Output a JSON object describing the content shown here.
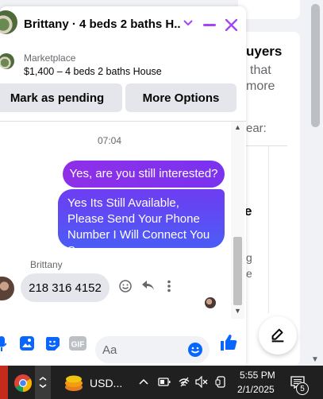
{
  "background": {
    "heading_fragment": "uyers",
    "line1": "that",
    "line2": "more",
    "line3": "ear:",
    "line4": "e",
    "line5": "g",
    "line6": "e"
  },
  "chat": {
    "title": "Brittany · 4 beds 2 baths H...",
    "marketplace_label": "Marketplace",
    "listing": "$1,400 – 4 beds 2 baths House",
    "mark_pending_label": "Mark as pending",
    "more_options_label": "More Options",
    "timestamp": "07:04",
    "messages": [
      {
        "from": "me",
        "text": "Yes, are you still interested?"
      },
      {
        "from": "me",
        "text": "Yes Its Still Available, Please Send Your Phone Number I Will Connect You Soon.."
      },
      {
        "from": "Brittany",
        "text": "218 316 4152"
      }
    ],
    "sender_name": "Brittany",
    "input_placeholder": "Aa"
  },
  "taskbar": {
    "app_label": "USD...",
    "time": "5:55 PM",
    "date": "2/1/2025",
    "notification_count": "5"
  },
  "colors": {
    "accent": "#a245f5",
    "bubble_start": "#8f2fe8",
    "bubble_end": "#4b5cf5",
    "messenger_blue": "#0866ff"
  }
}
